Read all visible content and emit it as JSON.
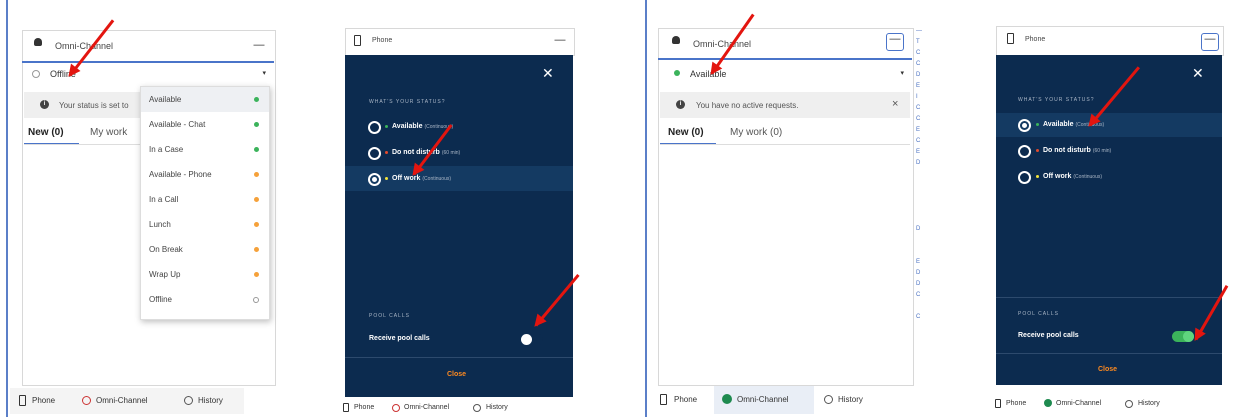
{
  "p1": {
    "header_title": "Omni-Channel",
    "minimize": "—",
    "status_value": "Offline",
    "banner_text": "Your status is set to",
    "tabs": [
      "New (0)",
      "My work"
    ],
    "dropdown": [
      {
        "label": "Available",
        "color": "#3bb35b"
      },
      {
        "label": "Available - Chat",
        "color": "#3bb35b"
      },
      {
        "label": "In a Case",
        "color": "#3bb35b"
      },
      {
        "label": "Available - Phone",
        "color": "#f5a13a"
      },
      {
        "label": "In a Call",
        "color": "#f5a13a"
      },
      {
        "label": "Lunch",
        "color": "#f5a13a"
      },
      {
        "label": "On Break",
        "color": "#f5a13a"
      },
      {
        "label": "Wrap Up",
        "color": "#f5a13a"
      },
      {
        "label": "Offline",
        "color": "ring"
      }
    ],
    "footer": [
      "Phone",
      "Omni-Channel",
      "History"
    ]
  },
  "p2": {
    "header_title": "Phone",
    "minimize": "—",
    "question": "WHAT'S YOUR STATUS?",
    "options": [
      {
        "label": "Available",
        "sub": "(Continuous)",
        "color": "#3bb35b",
        "selected": false
      },
      {
        "label": "Do not disturb",
        "sub": "(60 min)",
        "color": "#e24a2d",
        "selected": false
      },
      {
        "label": "Off work",
        "sub": "(Continuous)",
        "color": "#f2e33a",
        "selected": true
      }
    ],
    "pool_label": "POOL CALLS",
    "receive_label": "Receive pool calls",
    "toggle_on": false,
    "close_label": "Close",
    "footer": [
      "Phone",
      "Omni-Channel",
      "History"
    ]
  },
  "p3": {
    "header_title": "Omni-Channel",
    "minimize": "—",
    "status_value": "Available",
    "banner_text": "You have no active requests.",
    "banner_close": "×",
    "tabs": [
      "New (0)",
      "My work (0)"
    ],
    "footer": [
      "Phone",
      "Omni-Channel",
      "History"
    ]
  },
  "p4": {
    "header_title": "Phone",
    "minimize": "—",
    "question": "WHAT'S YOUR STATUS?",
    "options": [
      {
        "label": "Available",
        "sub": "(Continuous)",
        "color": "#3bb35b",
        "selected": true
      },
      {
        "label": "Do not disturb",
        "sub": "(60 min)",
        "color": "#e24a2d",
        "selected": false
      },
      {
        "label": "Off work",
        "sub": "(Continuous)",
        "color": "#f2e33a",
        "selected": false
      }
    ],
    "pool_label": "POOL CALLS",
    "receive_label": "Receive pool calls",
    "toggle_on": true,
    "close_label": "Close",
    "footer": [
      "Phone",
      "Omni-Channel",
      "History"
    ]
  },
  "colors": {
    "dark_panel": "#0c2b4f",
    "accent_orange": "#ff8a1f",
    "arrow_red": "#e3150f",
    "toggle_green": "#3bb35b"
  }
}
